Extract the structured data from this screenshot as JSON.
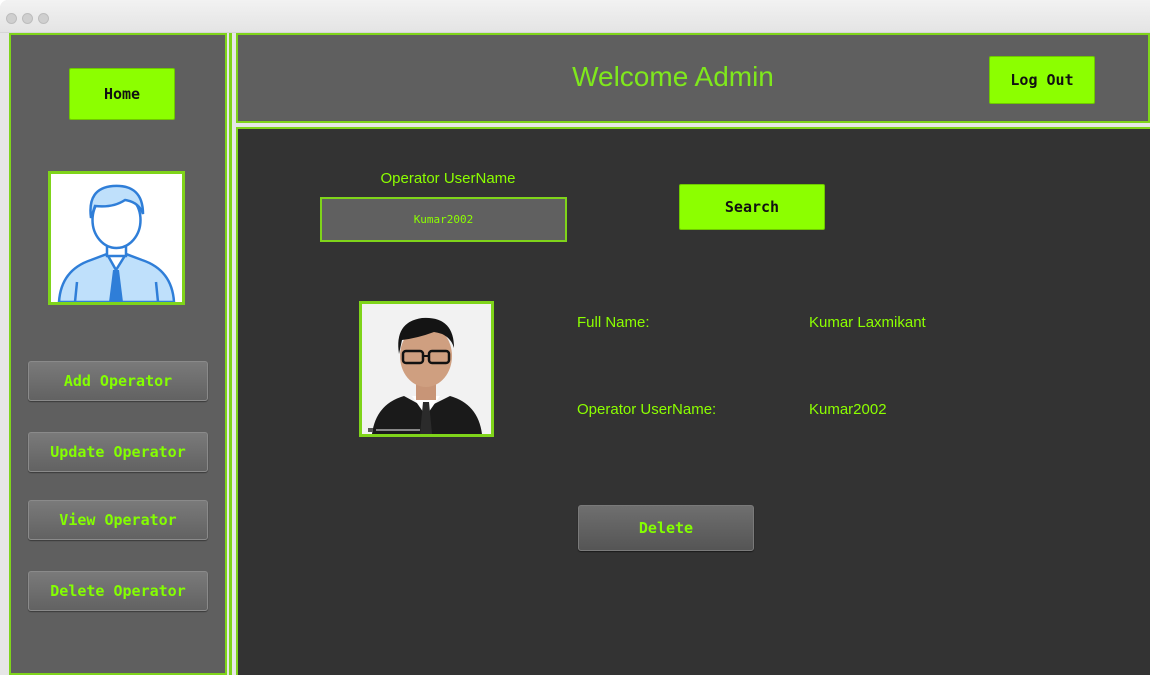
{
  "sidebar": {
    "home_label": "Home",
    "menu": [
      {
        "label": "Add Operator"
      },
      {
        "label": "Update Operator"
      },
      {
        "label": "View Operator"
      },
      {
        "label": "Delete Operator"
      }
    ]
  },
  "header": {
    "title": "Welcome Admin",
    "logout_label": "Log Out"
  },
  "search": {
    "label": "Operator UserName",
    "value": "Kumar2002",
    "button_label": "Search"
  },
  "operator": {
    "full_name_label": "Full Name:",
    "full_name": "Kumar Laxmikant",
    "username_label": "Operator UserName:",
    "username": "Kumar2002"
  },
  "delete_label": "Delete",
  "colors": {
    "accent": "#8cff00",
    "border_green": "#7fd41a",
    "panel_gray": "#5f5f5f",
    "content_dark": "#333333"
  },
  "icons": {
    "admin_avatar": "user-avatar-icon",
    "operator_photo": "operator-photo"
  }
}
